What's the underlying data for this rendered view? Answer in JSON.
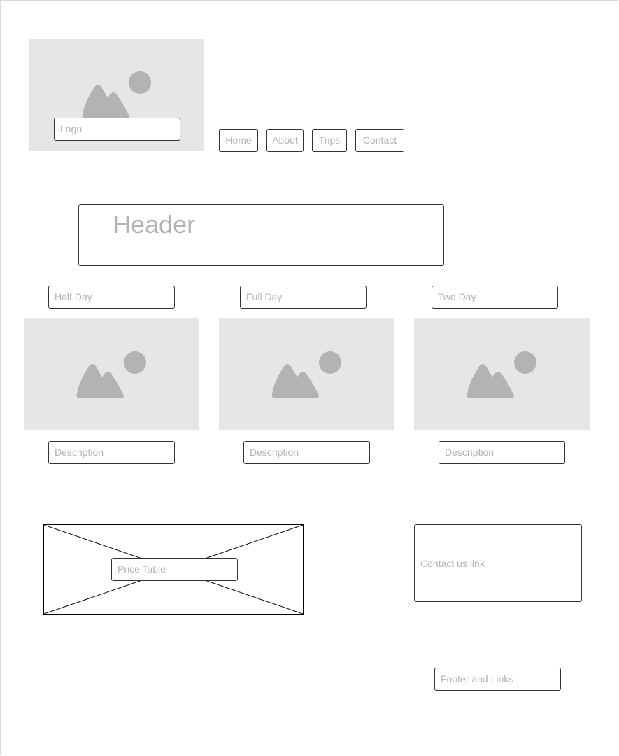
{
  "branding": {
    "logo_label": "Logo",
    "logo_icon": "image-placeholder-icon"
  },
  "nav": {
    "items": [
      {
        "label": "Home"
      },
      {
        "label": "About"
      },
      {
        "label": "Trips"
      },
      {
        "label": "Contact"
      }
    ]
  },
  "hero": {
    "header_text": "Header"
  },
  "trips": [
    {
      "title": "Half Day",
      "description": "Description",
      "image_icon": "image-placeholder-icon"
    },
    {
      "title": "Full Day",
      "description": "Description",
      "image_icon": "image-placeholder-icon"
    },
    {
      "title": "Two Day",
      "description": "Description",
      "image_icon": "image-placeholder-icon"
    }
  ],
  "pricing": {
    "label": "Price Table"
  },
  "contact": {
    "label": "Contact us link"
  },
  "footer": {
    "label": "Footer and Links"
  },
  "colors": {
    "placeholder_fill": "#e6e6e6",
    "placeholder_icon": "#b3b3b3",
    "border": "#333333",
    "text_muted": "#b3b3b3"
  }
}
